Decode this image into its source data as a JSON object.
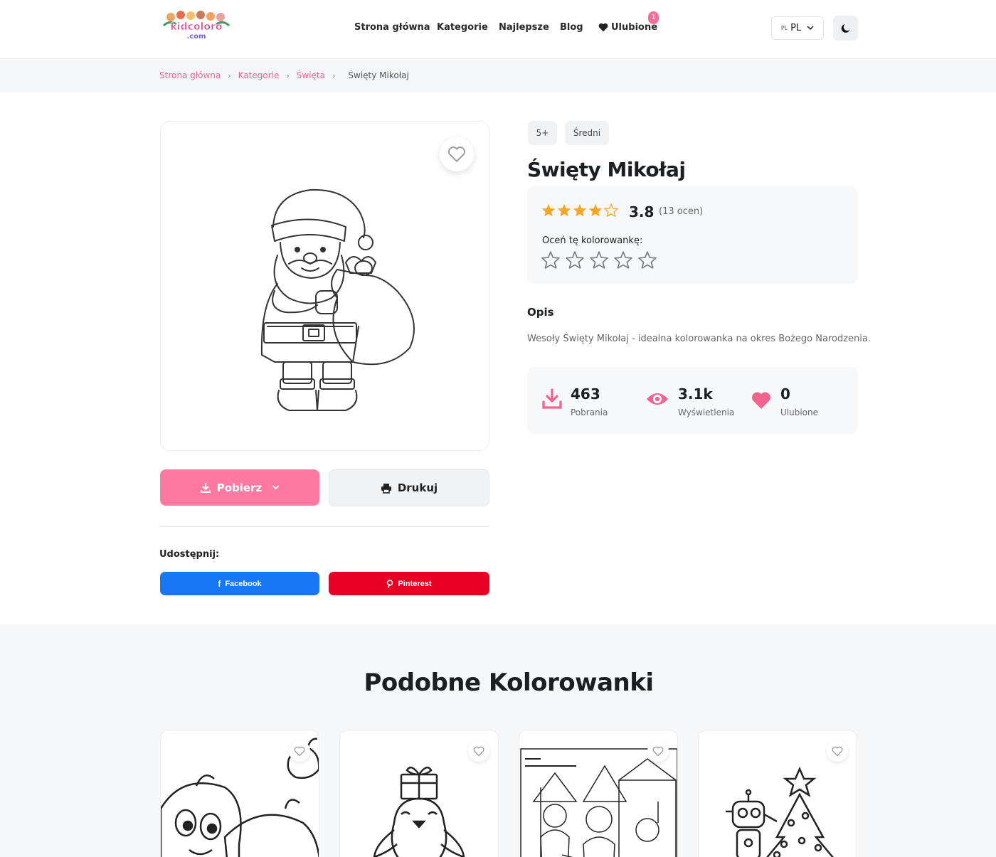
{
  "header": {
    "logo_text": "kidcoloro.com",
    "nav": [
      {
        "label": "Strona główna"
      },
      {
        "label": "Kategorie"
      },
      {
        "label": "Najlepsze"
      },
      {
        "label": "Blog"
      },
      {
        "label": "Ulubione",
        "icon": "heart-icon"
      }
    ],
    "favorites_badge": "1",
    "lang_small": "PL",
    "lang_label": "PL",
    "theme_icon": "moon-icon"
  },
  "breadcrumb": {
    "items": [
      "Strona główna",
      "Kategorie",
      "Święta"
    ],
    "current": "Święty Mikołaj"
  },
  "page": {
    "tags": [
      "5+",
      "Średni"
    ],
    "title": "Święty Mikołaj",
    "rating": {
      "score": "3.8",
      "count": "(13 ocen)",
      "filled_stars": 4,
      "total_stars": 5,
      "rate_label": "Oceń tę kolorowankę:"
    },
    "description_heading": "Opis",
    "description": "Wesoły Święty Mikołaj - idealna kolorowanka na okres Bożego Narodzenia.",
    "stats": [
      {
        "value": "463",
        "label": "Pobrania",
        "icon": "download-icon"
      },
      {
        "value": "3.1k",
        "label": "Wyświetlenia",
        "icon": "eye-icon"
      },
      {
        "value": "0",
        "label": "Ulubione",
        "icon": "heart-icon"
      }
    ],
    "download_label": "Pobierz",
    "print_label": "Drukuj",
    "share_label": "Udostępnij:",
    "facebook_label": "Facebook",
    "pinterest_label": "Pinterest"
  },
  "similar": {
    "title": "Podobne Kolorowanki",
    "cards": [
      {
        "subject": "pumpkins"
      },
      {
        "subject": "penguin"
      },
      {
        "subject": "gingerbread-scene"
      },
      {
        "subject": "robot-christmas-tree"
      }
    ]
  },
  "colors": {
    "accent_pink": "#ff7aa2",
    "link_pink": "#f0648f",
    "star_orange": "#f5a623",
    "facebook_blue": "#1877f2",
    "pinterest_red": "#e60023"
  }
}
